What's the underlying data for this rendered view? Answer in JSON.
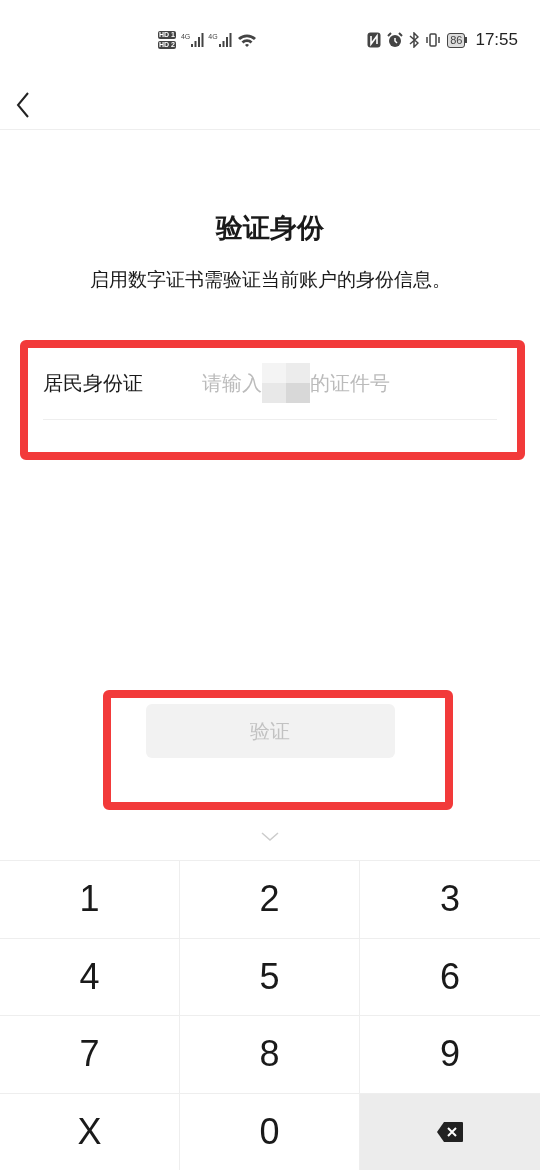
{
  "status_bar": {
    "sim_labels": [
      "HD 1",
      "HD 2"
    ],
    "network": [
      "4G",
      "4G"
    ],
    "battery": "86",
    "time": "17:55"
  },
  "title": "验证身份",
  "subtitle": "启用数字证书需验证当前账户的身份信息。",
  "id_field": {
    "label": "居民身份证",
    "placeholder_parts": [
      "请输入",
      "的证件号"
    ]
  },
  "verify_button": {
    "label": "验证",
    "disabled": true
  },
  "keypad": [
    {
      "kind": "digit",
      "label": "1"
    },
    {
      "kind": "digit",
      "label": "2"
    },
    {
      "kind": "digit",
      "label": "3"
    },
    {
      "kind": "digit",
      "label": "4"
    },
    {
      "kind": "digit",
      "label": "5"
    },
    {
      "kind": "digit",
      "label": "6"
    },
    {
      "kind": "digit",
      "label": "7"
    },
    {
      "kind": "digit",
      "label": "8"
    },
    {
      "kind": "digit",
      "label": "9"
    },
    {
      "kind": "digit",
      "label": "X"
    },
    {
      "kind": "digit",
      "label": "0"
    },
    {
      "kind": "backspace"
    }
  ]
}
